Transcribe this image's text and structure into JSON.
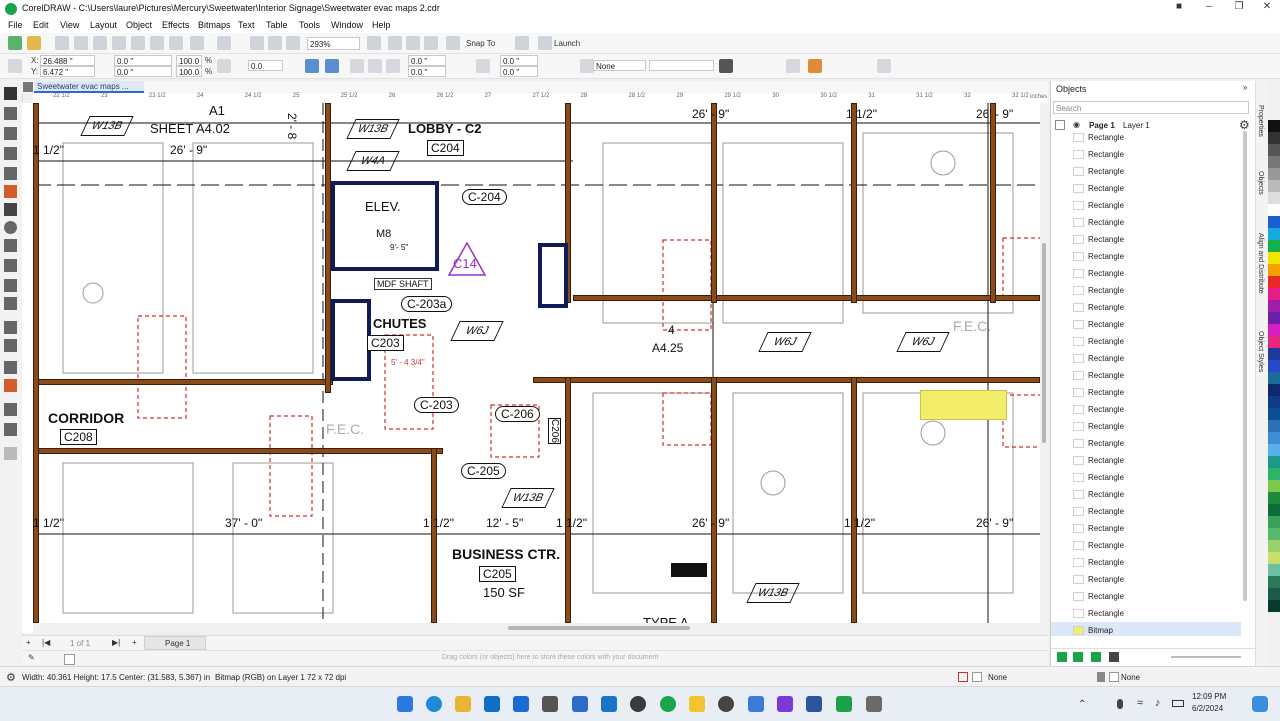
{
  "window": {
    "title": "CorelDRAW - C:\\Users\\laure\\Pictures\\Mercury\\Sweetwater\\Interior Signage\\Sweetwater evac maps 2.cdr"
  },
  "menu": [
    "File",
    "Edit",
    "View",
    "Layout",
    "Object",
    "Effects",
    "Bitmaps",
    "Text",
    "Table",
    "Tools",
    "Window",
    "Help"
  ],
  "toolbar": {
    "zoom": "293%",
    "snap_label": "Snap To",
    "launch_label": "Launch"
  },
  "propbar": {
    "x": "26.488 \"",
    "y": "6.472 \"",
    "w1": "0.0 \"",
    "w2": "0.0 \"",
    "sx": "100.0",
    "sy": "100.0",
    "pct1": "%",
    "pct2": "%",
    "angle": "0.0",
    "c1": "0.0 \"",
    "c2": "0.0 \"",
    "c3": "0.0 \"",
    "c4": "0.0 \"",
    "outline": "None",
    "xlabel": "X:",
    "ylabel": "Y:"
  },
  "doc_tab": "Sweetwater evac maps ...",
  "ruler": {
    "h": [
      "22 1/2",
      "23",
      "23 1/2",
      "24",
      "24 1/2",
      "25",
      "25 1/2",
      "26",
      "26 1/2",
      "27",
      "27 1/2",
      "28",
      "28 1/2",
      "29",
      "29 1/2",
      "30",
      "30 1/2",
      "31",
      "31 1/2",
      "32",
      "32 1/2"
    ],
    "unit": "inches"
  },
  "plan": {
    "labels": {
      "sheet": "SHEET A4.02",
      "lobby": "LOBBY - C2",
      "lobby_num": "C204",
      "elev": "ELEV.",
      "m8": "M8",
      "elev_dim": "9'- 5\"",
      "mdf": "MDF SHAFT",
      "chutes": "CHUTES",
      "c203_box": "C203",
      "c203_dim": "5' - 4 3/4\"",
      "c204_oval": "C-204",
      "c203a": "C-203a",
      "c203_oval": "C-203",
      "c206": "C-206",
      "c205_oval": "C-205",
      "c206_box": "C206",
      "corridor": "CORRIDOR",
      "corridor_num": "C208",
      "fec1": "F.E.C.",
      "fec2": "F.E.C.",
      "business": "BUSINESS CTR.",
      "business_num": "C205",
      "business_sf": "150 SF",
      "c14": "C14",
      "a1": "A1",
      "ref_num": "4",
      "ref_sheet": "A4.25",
      "type": "TYPE A",
      "dims": [
        "26' - 9\"",
        "1 1/2\"",
        "26' - 9\"",
        "1 1/2\"",
        "26' - 9\"",
        "1 1/2\"",
        "37' - 0\"",
        "1 1/2\"",
        "12' - 5\"",
        "1 1/2\"",
        "26' - 9\"",
        "1 1/2\"",
        "26' - 9\"",
        "2' - 8"
      ],
      "tags": [
        "W13B",
        "W13B",
        "W4A",
        "W6J",
        "W6J",
        "W6J",
        "W13B",
        "W13B"
      ]
    }
  },
  "page_nav": {
    "counter": "1 of 1",
    "page": "Page 1"
  },
  "palette_hint": "Drag colors (or objects) here to store these colors with your document",
  "panel": {
    "title": "Objects",
    "search_placeholder": "Search",
    "page": "Page 1",
    "layer": "Layer 1",
    "items": [
      "Rectangle",
      "Rectangle",
      "Rectangle",
      "Rectangle",
      "Rectangle",
      "Rectangle",
      "Rectangle",
      "Rectangle",
      "Rectangle",
      "Rectangle",
      "Rectangle",
      "Rectangle",
      "Rectangle",
      "Rectangle",
      "Rectangle",
      "Rectangle",
      "Rectangle",
      "Rectangle",
      "Rectangle",
      "Rectangle",
      "Rectangle",
      "Rectangle",
      "Rectangle",
      "Rectangle",
      "Rectangle",
      "Rectangle",
      "Rectangle",
      "Rectangle",
      "Rectangle"
    ],
    "selected": "Bitmap"
  },
  "dock_tabs": [
    "Properties",
    "Objects",
    "Align and Distribute",
    "Object Styles"
  ],
  "status": {
    "dims": "Width: 40.361  Height: 17.5  Center: (31.583, 5.367)  in",
    "info": "Bitmap (RGB) on Layer 1  72 x 72 dpi",
    "fill": "None",
    "outline": "None"
  },
  "taskbar": {
    "time": "12:09 PM",
    "date": "6/2/2024"
  },
  "colors": {
    "accent": "#1aa34a",
    "wall": "#8a4a1a",
    "highlight": "#f2ee6a",
    "triangle": "#9b30c8",
    "egress": "#d03030"
  }
}
